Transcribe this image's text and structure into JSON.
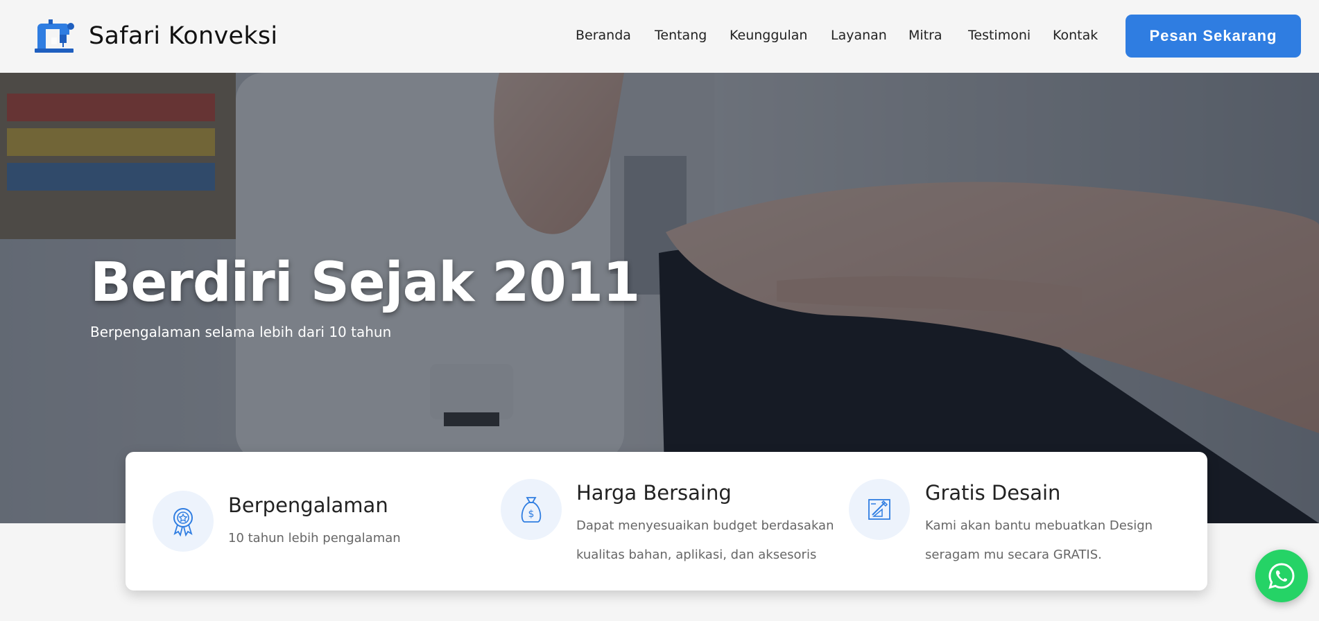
{
  "brand": {
    "name": "Safari Konveksi",
    "logo_icon": "sewing-machine-icon"
  },
  "nav": {
    "items": [
      {
        "label": "Beranda"
      },
      {
        "label": "Tentang"
      },
      {
        "label": "Keunggulan"
      },
      {
        "label": "Layanan"
      },
      {
        "label": "Mitra"
      },
      {
        "label": "Testimoni"
      },
      {
        "label": "Kontak"
      }
    ],
    "cta_label": "Pesan Sekarang"
  },
  "hero": {
    "title": "Berdiri Sejak 2011",
    "subtitle": "Berpengalaman selama lebih dari 10 tahun"
  },
  "features": [
    {
      "icon": "award-badge-icon",
      "title": "Berpengalaman",
      "desc_line1": "10 tahun lebih pengalaman",
      "desc_line2": ""
    },
    {
      "icon": "money-bag-icon",
      "title": "Harga Bersaing",
      "desc_line1": "Dapat menyesuaikan budget berdasakan",
      "desc_line2": "kualitas bahan, aplikasi, dan aksesoris"
    },
    {
      "icon": "design-tools-icon",
      "title": "Gratis Desain",
      "desc_line1": "Kami akan bantu mebuatkan Design",
      "desc_line2": "seragam mu secara GRATIS."
    }
  ],
  "colors": {
    "accent": "#2f7de1",
    "whatsapp": "#25d366",
    "icon_bg": "#edf3fc"
  },
  "floating": {
    "whatsapp_icon": "whatsapp-icon"
  }
}
